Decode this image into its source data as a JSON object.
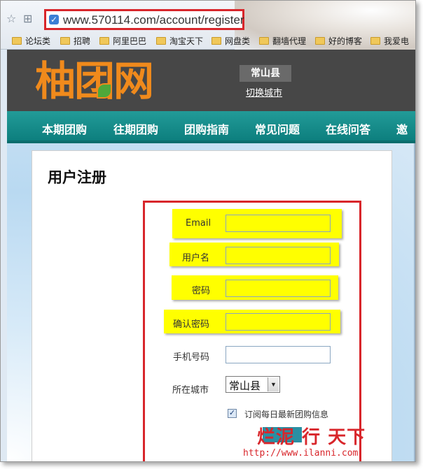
{
  "browser": {
    "url": "www.570114.com/account/register",
    "bookmarks": [
      "论坛类",
      "招聘",
      "阿里巴巴",
      "淘宝天下",
      "网盘类",
      "翻墙代理",
      "好的博客",
      "我爱电"
    ]
  },
  "site": {
    "logo_text": "柚团网",
    "current_city": "常山县",
    "switch_city_link": "切换城市"
  },
  "nav": {
    "items": [
      "本期团购",
      "往期团购",
      "团购指南",
      "常见问题",
      "在线问答",
      "邀"
    ]
  },
  "form": {
    "title": "用户注册",
    "email_label": "Email",
    "username_label": "用户名",
    "password_label": "密码",
    "confirm_password_label": "确认密码",
    "phone_label": "手机号码",
    "city_label": "所在城市",
    "city_value": "常山县",
    "subscribe_label": "订阅每日最新团购信息",
    "subscribe_checked": true
  },
  "watermark": {
    "text": "烂泥 行 天下",
    "url": "http://www.ilanni.com"
  },
  "colors": {
    "highlight": "#ffff00",
    "annotation_red": "#d8262b",
    "nav_teal": "#148a88",
    "logo_orange": "#f08a1c"
  }
}
